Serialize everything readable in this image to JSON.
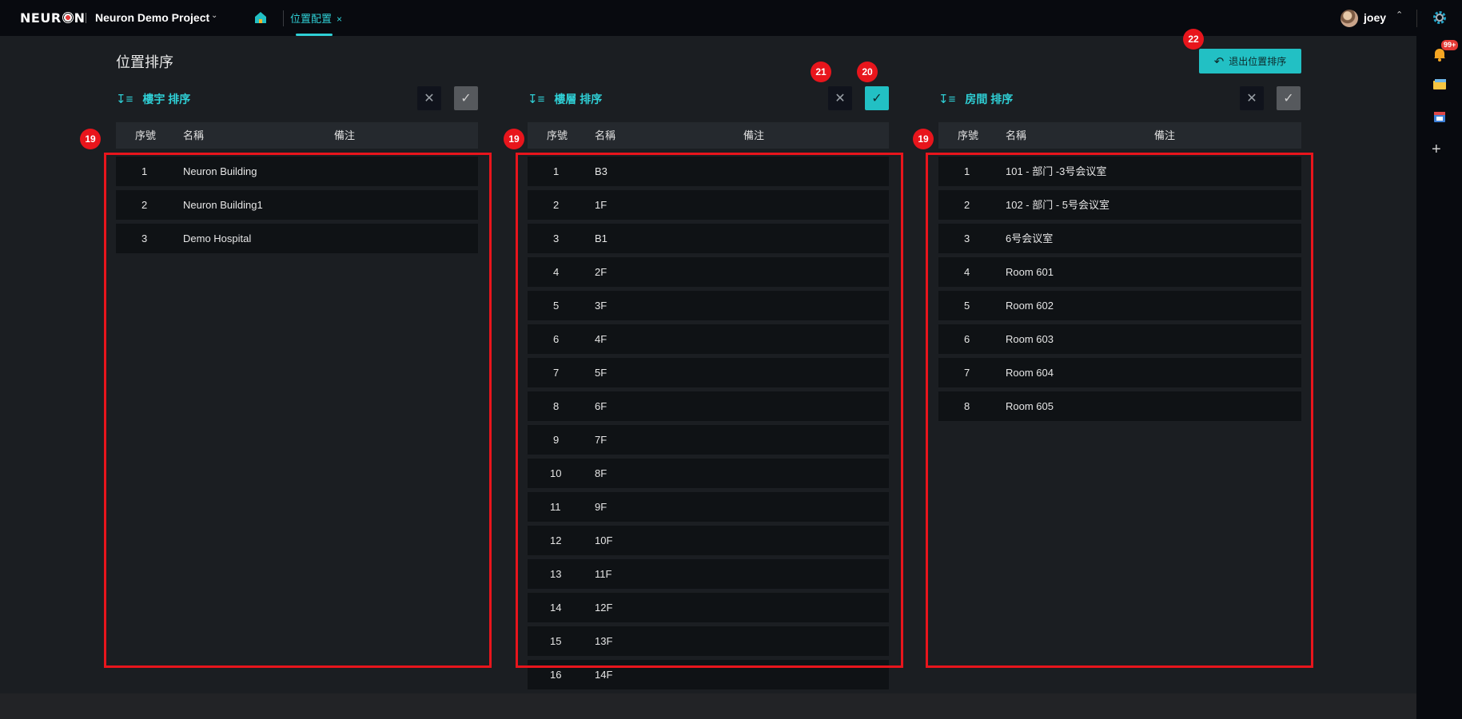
{
  "header": {
    "logo": "NEURON",
    "project": "Neuron Demo Project",
    "tab_label": "位置配置",
    "tab_close": "×",
    "user": "joey"
  },
  "notifications": {
    "badge": "99+"
  },
  "page": {
    "title": "位置排序",
    "exit_label": "退出位置排序"
  },
  "columns": [
    {
      "title": "樓宇 排序",
      "headers": [
        "序號",
        "名稱",
        "備注"
      ],
      "rows": [
        {
          "n": "1",
          "name": "Neuron Building"
        },
        {
          "n": "2",
          "name": "Neuron Building1"
        },
        {
          "n": "3",
          "name": "Demo Hospital"
        }
      ]
    },
    {
      "title": "樓層 排序",
      "headers": [
        "序號",
        "名稱",
        "備注"
      ],
      "rows": [
        {
          "n": "1",
          "name": "B3"
        },
        {
          "n": "2",
          "name": "1F"
        },
        {
          "n": "3",
          "name": "B1"
        },
        {
          "n": "4",
          "name": "2F"
        },
        {
          "n": "5",
          "name": "3F"
        },
        {
          "n": "6",
          "name": "4F"
        },
        {
          "n": "7",
          "name": "5F"
        },
        {
          "n": "8",
          "name": "6F"
        },
        {
          "n": "9",
          "name": "7F"
        },
        {
          "n": "10",
          "name": "8F"
        },
        {
          "n": "11",
          "name": "9F"
        },
        {
          "n": "12",
          "name": "10F"
        },
        {
          "n": "13",
          "name": "11F"
        },
        {
          "n": "14",
          "name": "12F"
        },
        {
          "n": "15",
          "name": "13F"
        },
        {
          "n": "16",
          "name": "14F"
        }
      ]
    },
    {
      "title": "房間 排序",
      "headers": [
        "序號",
        "名稱",
        "備注"
      ],
      "rows": [
        {
          "n": "1",
          "name": "101 - 部门 -3号会议室"
        },
        {
          "n": "2",
          "name": "102 - 部门 - 5号会议室"
        },
        {
          "n": "3",
          "name": "6号会议室"
        },
        {
          "n": "4",
          "name": "Room 601"
        },
        {
          "n": "5",
          "name": "Room 602"
        },
        {
          "n": "6",
          "name": "Room 603"
        },
        {
          "n": "7",
          "name": "Room 604"
        },
        {
          "n": "8",
          "name": "Room 605"
        }
      ]
    }
  ],
  "annotations": {
    "list": "19",
    "confirm": "20",
    "cancel": "21",
    "exit": "22"
  },
  "colors": {
    "accent": "#22c0c4",
    "annotation": "#e8151c"
  }
}
